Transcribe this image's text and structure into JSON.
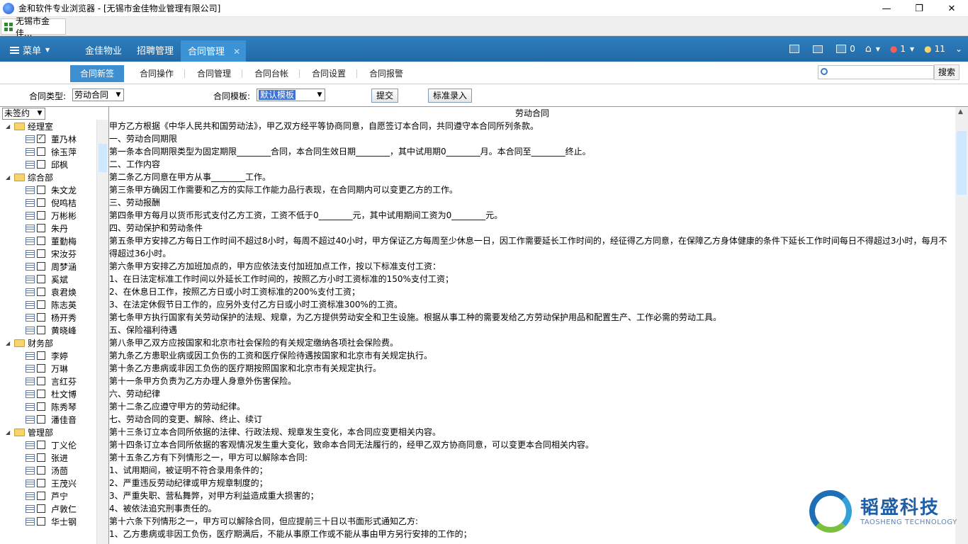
{
  "window": {
    "title": "金和软件专业浏览器 - [无锡市金佳物业管理有限公司]",
    "minimize": "—",
    "restore": "❐",
    "close": "✕"
  },
  "browser_tab": {
    "label": "无锡市金佳..."
  },
  "appbar": {
    "menu_label": "菜单",
    "nav": [
      "金佳物业",
      "招聘管理",
      "合同管理"
    ],
    "active_nav_close": "✕",
    "counts": {
      "docs": "0",
      "alerts": "1",
      "users": "11"
    }
  },
  "subnav": {
    "tabs": [
      "合同新签",
      "合同操作",
      "合同管理",
      "合同台帐",
      "合同设置",
      "合同报警"
    ],
    "search_placeholder": "",
    "search_button": "搜索"
  },
  "filters": {
    "type_label": "合同类型:",
    "type_value": "劳动合同",
    "template_label": "合同模板:",
    "template_value": "默认模板",
    "submit": "提交",
    "standard_entry": "标准录入"
  },
  "tree": {
    "status_value": "未签约",
    "departments": [
      {
        "name": "经理室",
        "employees": [
          {
            "name": "董乃林",
            "checked": true
          },
          {
            "name": "徐玉萍",
            "checked": false
          },
          {
            "name": "邱枫",
            "checked": false
          }
        ]
      },
      {
        "name": "综合部",
        "employees": [
          {
            "name": "朱文龙",
            "checked": false
          },
          {
            "name": "倪鸣桔",
            "checked": false
          },
          {
            "name": "万彬彬",
            "checked": false
          },
          {
            "name": "朱丹",
            "checked": false
          },
          {
            "name": "董勤梅",
            "checked": false
          },
          {
            "name": "宋汝芬",
            "checked": false
          },
          {
            "name": "周梦涵",
            "checked": false
          },
          {
            "name": "奚斌",
            "checked": false
          },
          {
            "name": "袁君焕",
            "checked": false
          },
          {
            "name": "陈志英",
            "checked": false
          },
          {
            "name": "杨开秀",
            "checked": false
          },
          {
            "name": "黄晓峰",
            "checked": false
          }
        ]
      },
      {
        "name": "财务部",
        "employees": [
          {
            "name": "李婷",
            "checked": false
          },
          {
            "name": "万琳",
            "checked": false
          },
          {
            "name": "言红芬",
            "checked": false
          },
          {
            "name": "杜文博",
            "checked": false
          },
          {
            "name": "陈秀琴",
            "checked": false
          },
          {
            "name": "潘佳音",
            "checked": false
          }
        ]
      },
      {
        "name": "管理部",
        "employees": [
          {
            "name": "丁义伦",
            "checked": false
          },
          {
            "name": "张进",
            "checked": false
          },
          {
            "name": "汤茴",
            "checked": false
          },
          {
            "name": "王茂兴",
            "checked": false
          },
          {
            "name": "芦宁",
            "checked": false
          },
          {
            "name": "卢敦仁",
            "checked": false
          },
          {
            "name": "华士钢",
            "checked": false
          }
        ]
      }
    ]
  },
  "document": {
    "title": "劳动合同",
    "lines": [
      "甲方乙方根据《中华人民共和国劳动法》，甲乙双方经平等协商同意，自愿签订本合同，共同遵守本合同所列条款。",
      "一、劳动合同期限",
      "第一条本合同期限类型为固定期限________合同，本合同生效日期________，其中试用期0________月。本合同至________终止。",
      "二、工作内容",
      "第二条乙方同意在甲方从事________工作。",
      "第三条甲方确因工作需要和乙方的实际工作能力品行表现，在合同期内可以变更乙方的工作。",
      "三、劳动报酬",
      "第四条甲方每月以货币形式支付乙方工资，工资不低于0________元，其中试用期间工资为0________元。",
      "四、劳动保护和劳动条件",
      "第五条甲方安排乙方每日工作时间不超过8小时，每周不超过40小时，甲方保证乙方每周至少休息一日，因工作需要延长工作时间的，经征得乙方同意，在保障乙方身体健康的条件下延长工作时间每日不得超过3小时，每月不得超过36小时。",
      "第六条甲方安排乙方加班加点的，甲方应依法支付加班加点工作，按以下标准支付工资：",
      "1、在日法定标准工作时间以外延长工作时间的，按照乙方小时工资标准的150%支付工资；",
      "2、在休息日工作，按照乙方日或小时工资标准的200%支付工资；",
      "3、在法定休假节日工作的，应另外支付乙方日或小时工资标准300%的工资。",
      "第七条甲方执行国家有关劳动保护的法规、规章，为乙方提供劳动安全和卫生设施。根据从事工种的需要发给乙方劳动保护用品和配置生产、工作必需的劳动工具。",
      "五、保险福利待遇",
      "第八条甲乙双方应按国家和北京市社会保险的有关规定缴纳各项社会保险费。",
      "第九条乙方患职业病或因工负伤的工资和医疗保险待遇按国家和北京市有关规定执行。",
      "第十条乙方患病或非因工负伤的医疗期按照国家和北京市有关规定执行。",
      "第十一条甲方负责为乙方办理人身意外伤害保险。",
      "六、劳动纪律",
      "第十二条乙应遵守甲方的劳动纪律。",
      "七、劳动合同的变更、解除、终止、续订",
      "第十三条订立本合同所依据的法律、行政法规、规章发生变化，本合同应变更相关内容。",
      "第十四条订立本合同所依据的客观情况发生重大变化，致命本合同无法履行的，经甲乙双方协商同意，可以变更本合同相关内容。",
      "第十五条乙方有下列情形之一，甲方可以解除本合同:",
      "1、试用期间，被证明不符合录用条件的；",
      "2、严重违反劳动纪律或甲方规章制度的；",
      "3、严重失职、营私舞弊，对甲方利益造成重大损害的；",
      "4、被依法追究刑事责任的。",
      "第十六条下列情形之一，甲方可以解除合同，但应提前三十日以书面形式通知乙方:",
      "1、乙方患病或非因工负伤，医疗期满后，不能从事原工作或不能从事由甲方另行安排的工作的；"
    ]
  },
  "logo": {
    "brand": "韬盛科技",
    "sub": "TAOSHENG TECHNOLOGY"
  },
  "colors": {
    "appbar": "#2a75b3",
    "active_tab": "#3d8fd1",
    "logo_blue": "#1e5fa6",
    "logo_green": "#7cc042"
  }
}
